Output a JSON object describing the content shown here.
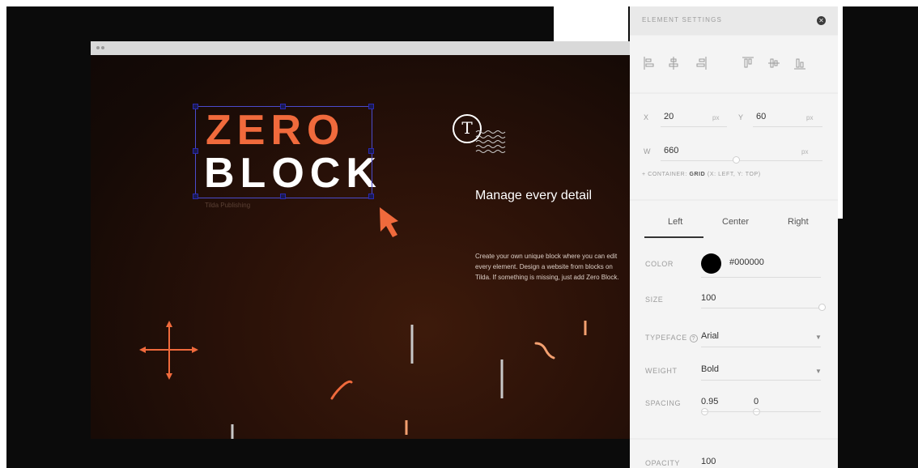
{
  "preview": {
    "logo_line1": "ZERO",
    "logo_line2": "BLOCK",
    "logo_caption": "Tilda Publishing",
    "brand_glyph": "T",
    "headline": "Manage every detail",
    "body": "Create your own unique block where you can edit every element. Design a website from blocks on Tilda. If something is missing, just add Zero Block.",
    "accent_color": "#f06a3c"
  },
  "panel": {
    "title": "ELEMENT SETTINGS",
    "close_icon": "close-icon",
    "position": {
      "x_label": "X",
      "x_value": "20",
      "x_unit": "px",
      "y_label": "Y",
      "y_value": "60",
      "y_unit": "px",
      "w_label": "W",
      "w_value": "660",
      "w_unit": "px",
      "container_prefix": "+ CONTAINER:",
      "container_value": "GRID",
      "container_suffix": "(X: LEFT, Y: TOP)"
    },
    "align_tabs": [
      "Left",
      "Center",
      "Right"
    ],
    "selected_align": "Left",
    "color_label": "COLOR",
    "color_value": "#000000",
    "size_label": "SIZE",
    "size_value": "100",
    "typeface_label": "TYPEFACE",
    "typeface_value": "Arial",
    "weight_label": "WEIGHT",
    "weight_value": "Bold",
    "spacing_label": "SPACING",
    "spacing_value": "0.95",
    "spacing_value2": "0",
    "opacity_label": "OPACITY",
    "opacity_value": "100"
  }
}
